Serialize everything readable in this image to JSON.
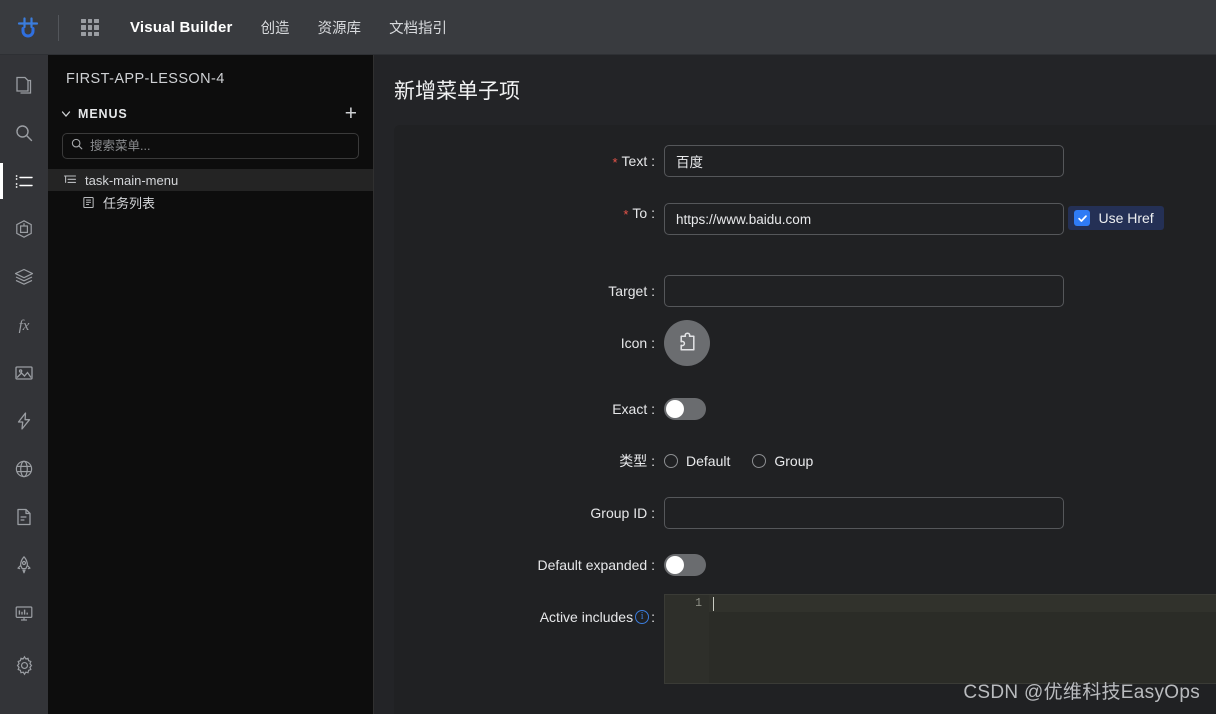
{
  "topbar": {
    "logo": "easyops-logo-icon",
    "apps_icon": "apps-grid-icon",
    "title": "Visual Builder",
    "nav": [
      {
        "label": "创造"
      },
      {
        "label": "资源库"
      },
      {
        "label": "文档指引"
      }
    ]
  },
  "rail": {
    "items": [
      {
        "name": "pages-icon",
        "active": false
      },
      {
        "name": "search-icon",
        "active": false
      },
      {
        "name": "menus-list-icon",
        "active": true
      },
      {
        "name": "package-icon",
        "active": false
      },
      {
        "name": "layers-icon",
        "active": false
      },
      {
        "name": "function-fx-icon",
        "active": false
      },
      {
        "name": "image-icon",
        "active": false
      },
      {
        "name": "lightning-icon",
        "active": false
      },
      {
        "name": "globe-icon",
        "active": false
      },
      {
        "name": "document-icon",
        "active": false
      },
      {
        "name": "rocket-icon",
        "active": false
      },
      {
        "name": "chart-monitor-icon",
        "active": false
      },
      {
        "name": "settings-gear-icon",
        "active": false
      }
    ]
  },
  "panel": {
    "project_title": "FIRST-APP-LESSON-4",
    "section_label": "MENUS",
    "add_label": "+",
    "search": {
      "placeholder": "搜索菜单...",
      "value": ""
    },
    "tree": [
      {
        "label": "task-main-menu",
        "icon": "menu-tree-icon",
        "selected": true,
        "child": false
      },
      {
        "label": "任务列表",
        "icon": "menu-item-icon",
        "selected": false,
        "child": true
      }
    ]
  },
  "main": {
    "page_title": "新增菜单子项",
    "fields": {
      "text": {
        "label": "Text",
        "required": true,
        "value": "百度"
      },
      "to": {
        "label": "To",
        "required": true,
        "value": "https://www.baidu.com"
      },
      "use_href": {
        "label": "Use Href",
        "checked": true
      },
      "target": {
        "label": "Target",
        "required": false,
        "value": "",
        "placeholder": ""
      },
      "icon": {
        "label": "Icon",
        "glyph": "puzzle-piece-icon"
      },
      "exact": {
        "label": "Exact",
        "on": false
      },
      "type": {
        "label": "类型",
        "options": [
          {
            "label": "Default",
            "selected": false
          },
          {
            "label": "Group",
            "selected": false
          }
        ]
      },
      "group_id": {
        "label": "Group ID",
        "required": false,
        "value": "",
        "placeholder": ""
      },
      "default_expanded": {
        "label": "Default expanded",
        "on": false
      },
      "active_includes": {
        "label": "Active includes",
        "info_glyph": "i",
        "line_number": "1",
        "value": ""
      }
    }
  },
  "watermark": {
    "text": "CSDN @优维科技EasyOps"
  },
  "colors": {
    "topbar_bg": "#393b3f",
    "rail_bg": "#333438",
    "panel_bg": "#0d0d0d",
    "main_bg": "#232427",
    "card_bg": "#202123",
    "accent_blue": "#2f7bf5",
    "required_red": "#e8544a",
    "checkbox_pill_bg": "#243055",
    "editor_bg": "#2b2c27"
  }
}
